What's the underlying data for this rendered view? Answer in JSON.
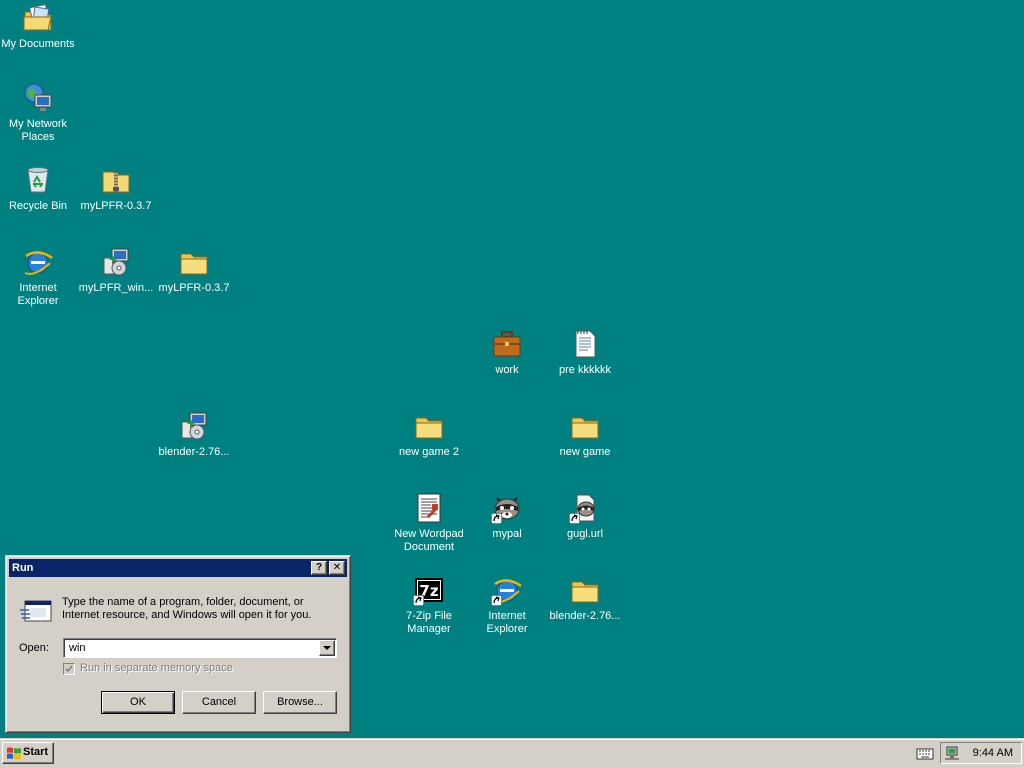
{
  "desktop": {
    "icons": [
      {
        "label": "My Documents",
        "icon": "my-documents-icon"
      },
      {
        "label": "My Network\nPlaces",
        "icon": "network-places-icon"
      },
      {
        "label": "Recycle Bin",
        "icon": "recycle-bin-icon"
      },
      {
        "label": "myLPFR-0.3.7",
        "icon": "zip-folder-icon"
      },
      {
        "label": "Internet\nExplorer",
        "icon": "internet-explorer-icon"
      },
      {
        "label": "myLPFR_win...",
        "icon": "installer-icon"
      },
      {
        "label": "myLPFR-0.3.7",
        "icon": "folder-icon"
      },
      {
        "label": "work",
        "icon": "briefcase-icon"
      },
      {
        "label": "pre kkkkkk",
        "icon": "text-document-icon"
      },
      {
        "label": "blender-2.76...",
        "icon": "installer-icon"
      },
      {
        "label": "new game 2",
        "icon": "folder-icon"
      },
      {
        "label": "new game",
        "icon": "folder-icon"
      },
      {
        "label": "New Wordpad\nDocument",
        "icon": "wordpad-document-icon"
      },
      {
        "label": "mypal",
        "icon": "mypal-raccoon-icon"
      },
      {
        "label": "gugl.url",
        "icon": "url-shortcut-icon"
      },
      {
        "label": "7-Zip File\nManager",
        "icon": "seven-zip-icon"
      },
      {
        "label": "Internet\nExplorer",
        "icon": "internet-explorer-icon"
      },
      {
        "label": "blender-2.76...",
        "icon": "folder-icon"
      }
    ]
  },
  "run_dialog": {
    "title": "Run",
    "help_label": "?",
    "close_label": "✕",
    "description": "Type the name of a program, folder, document, or Internet resource, and Windows will open it for you.",
    "open_label": "Open:",
    "open_value": "win",
    "separate_memory_label": "Run in separate memory space",
    "ok_label": "OK",
    "cancel_label": "Cancel",
    "browse_label": "Browse..."
  },
  "taskbar": {
    "start_label": "Start",
    "clock": "9:44 AM"
  },
  "colors": {
    "desktop": "#008080",
    "titlebar": "#0a246a",
    "face": "#d4d0c8"
  }
}
